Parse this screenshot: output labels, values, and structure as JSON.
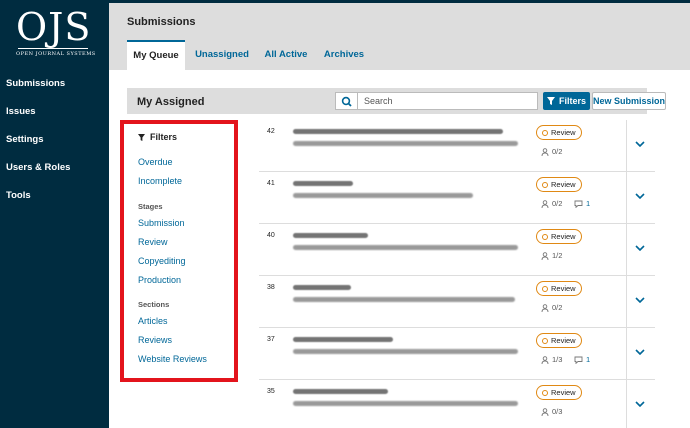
{
  "sidebar": {
    "logo": {
      "main": "OJS",
      "sub": "OPEN JOURNAL SYSTEMS"
    },
    "items": [
      {
        "label": "Submissions"
      },
      {
        "label": "Issues"
      },
      {
        "label": "Settings"
      },
      {
        "label": "Users & Roles"
      },
      {
        "label": "Tools"
      }
    ]
  },
  "header": {
    "title": "Submissions"
  },
  "tabs": [
    {
      "label": "My Queue",
      "active": true
    },
    {
      "label": "Unassigned",
      "active": false
    },
    {
      "label": "All Active",
      "active": false
    },
    {
      "label": "Archives",
      "active": false
    }
  ],
  "list": {
    "title": "My Assigned",
    "search_placeholder": "Search",
    "filters_label": "Filters",
    "new_submission_label": "New Submission"
  },
  "filters_panel": {
    "heading": "Filters",
    "general": [
      "Overdue",
      "Incomplete"
    ],
    "stages_heading": "Stages",
    "stages": [
      "Submission",
      "Review",
      "Copyediting",
      "Production"
    ],
    "sections_heading": "Sections",
    "sections": [
      "Articles",
      "Reviews",
      "Website Reviews"
    ]
  },
  "submissions": [
    {
      "id": "42",
      "stage": "Review",
      "reviews": "0/2",
      "discussions": ""
    },
    {
      "id": "41",
      "stage": "Review",
      "reviews": "0/2",
      "discussions": "1"
    },
    {
      "id": "40",
      "stage": "Review",
      "reviews": "1/2",
      "discussions": ""
    },
    {
      "id": "38",
      "stage": "Review",
      "reviews": "0/2",
      "discussions": ""
    },
    {
      "id": "37",
      "stage": "Review",
      "reviews": "1/3",
      "discussions": "1"
    },
    {
      "id": "35",
      "stage": "Review",
      "reviews": "0/3",
      "discussions": ""
    }
  ],
  "colors": {
    "sidebar_bg": "#002c40",
    "accent": "#006798",
    "stage_review": "#e08914",
    "highlight_box": "#e3141c"
  }
}
